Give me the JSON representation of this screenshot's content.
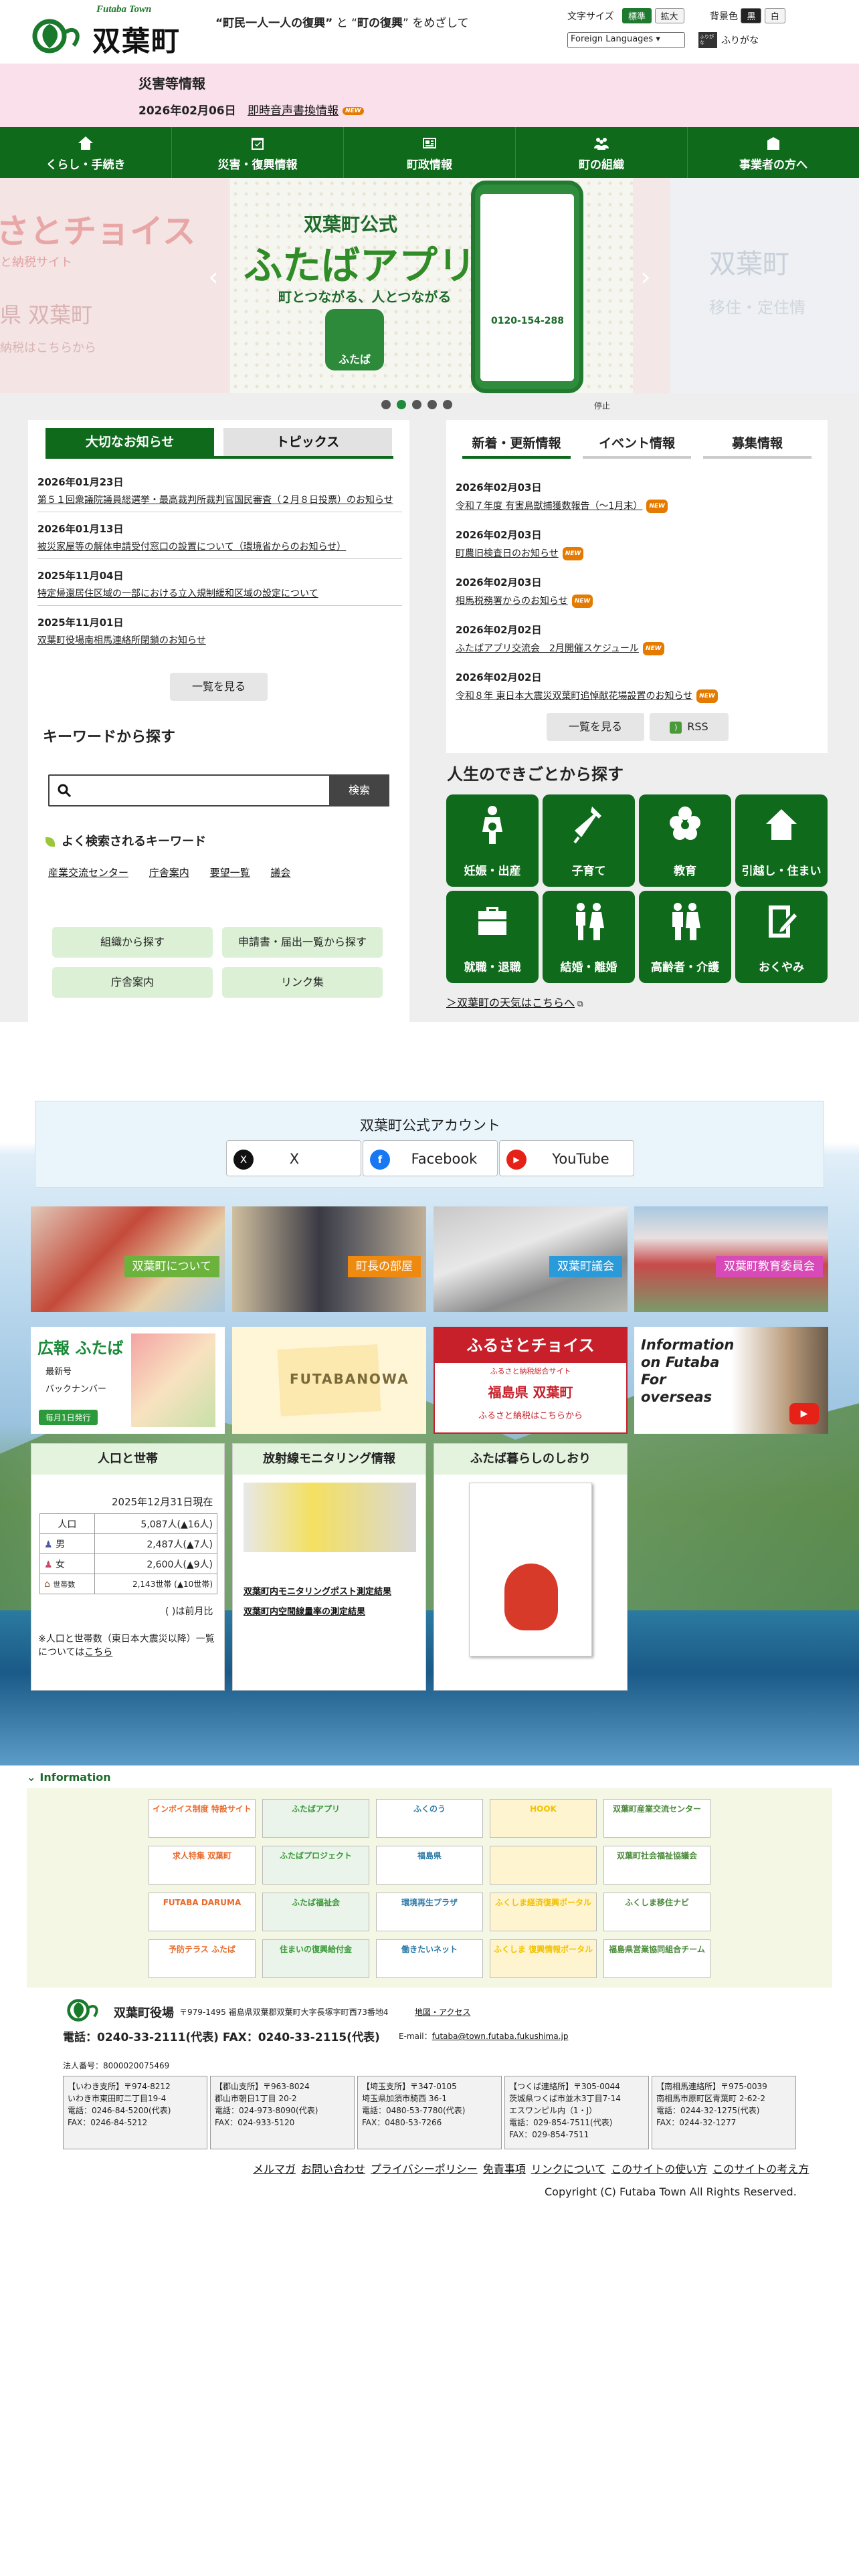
{
  "header": {
    "logo_en": "Futaba Town",
    "logo_jp": "双葉町",
    "slogan_a": "“町民一人一人の復興”",
    "slogan_mid": " と “",
    "slogan_b": "町の復興",
    "slogan_c": "” をめざして",
    "fontsize_label": "文字サイズ",
    "fontsize_std": "標準",
    "fontsize_big": "拡大",
    "bg_label": "背景色",
    "bg_black": "黒",
    "bg_white": "白",
    "lang_select": "Foreign Languages ▾",
    "furigana_icon_label": "ふりがな",
    "furigana": "ふりがな"
  },
  "disaster": {
    "title": "災害等情報",
    "date": "2026年02月06日",
    "link": "即時音声書換情報",
    "new": "NEW"
  },
  "nav": [
    {
      "label": "くらし・手続き"
    },
    {
      "label": "災害・復興情報"
    },
    {
      "label": "町政情報"
    },
    {
      "label": "町の組織"
    },
    {
      "label": "事業者の方へ"
    }
  ],
  "slider": {
    "left_big": "さとチョイス",
    "left_sub": "と納税サイト",
    "left_town": "県 双葉町",
    "left_link": "納税はこちらから",
    "app_t1": "双葉町公式",
    "app_t2": "ふたばアプリ",
    "app_t3": "町とつながる、人とつながる",
    "app_icon": "ふたば",
    "phone_tel": "0120-154-288",
    "right_t1": "双葉町",
    "right_t2": "移住・定住情",
    "stop": "停止",
    "dots": 5,
    "active_dot": 1
  },
  "important": {
    "tab_on": "大切なお知らせ",
    "tab_off": "トピックス",
    "items": [
      {
        "date": "2026年01月23日",
        "text": "第５１回衆議院議員総選挙・最高裁判所裁判官国民審査（２月８日投票）のお知らせ"
      },
      {
        "date": "2026年01月13日",
        "text": "被災家屋等の解体申請受付窓口の設置について（環境省からのお知らせ）"
      },
      {
        "date": "2025年11月04日",
        "text": "特定帰還居住区域の一部における立入規制緩和区域の設定について"
      },
      {
        "date": "2025年11月01日",
        "text": "双葉町役場南相馬連絡所閉鎖のお知らせ"
      }
    ],
    "more": "一覧を見る"
  },
  "keyword": {
    "title": "キーワードから探す",
    "placeholder": "",
    "search_btn": "検索",
    "freq_title": "よく検索されるキーワード",
    "freq": [
      "産業交流センター",
      "庁舎案内",
      "要望一覧",
      "議会"
    ],
    "btns": [
      "組織から探す",
      "申請書・届出一覧から探す",
      "庁舎案内",
      "リンク集"
    ]
  },
  "news": {
    "tabs": [
      "新着・更新情報",
      "イベント情報",
      "募集情報"
    ],
    "items": [
      {
        "date": "2026年02月03日",
        "text": "令和７年度 有害鳥獣捕獲数報告（～1月末）"
      },
      {
        "date": "2026年02月03日",
        "text": "町農旧検査日のお知らせ"
      },
      {
        "date": "2026年02月03日",
        "text": "相馬税務署からのお知らせ"
      },
      {
        "date": "2026年02月02日",
        "text": "ふたばアプリ交流会　2月開催スケジュール"
      },
      {
        "date": "2026年02月02日",
        "text": "令和８年 東日本大震災双葉町追悼献花場設置のお知らせ"
      }
    ],
    "new": "NEW",
    "more": "一覧を見る",
    "rss": "RSS"
  },
  "life": {
    "title": "人生のできごとから探す",
    "items": [
      "妊娠・出産",
      "子育て",
      "教育",
      "引越し・住まい",
      "就職・退職",
      "結婚・離婚",
      "高齢者・介護",
      "おくやみ"
    ],
    "weather": "＞双葉町の天気はこちらへ"
  },
  "sns": {
    "title": "双葉町公式アカウント",
    "items": [
      {
        "label": "X",
        "icon": "X"
      },
      {
        "label": "Facebook",
        "icon": "f"
      },
      {
        "label": "YouTube",
        "icon": "▶"
      }
    ]
  },
  "photos": [
    {
      "label": "双葉町について"
    },
    {
      "label": "町長の部屋"
    },
    {
      "label": "双葉町議会"
    },
    {
      "label": "双葉町教育委員会"
    }
  ],
  "banners": {
    "koho_t": "広報 ふたば",
    "koho_a": "最新号",
    "koho_b": "バックナンバー",
    "koho_c": "毎月1日発行",
    "futabanowa": "FUTABANOWA",
    "furusato_t": "ふるさとチョイス",
    "furusato_s": "ふるさと納税総合サイト",
    "furusato_town": "福島県 双葉町",
    "furusato_link": "ふるさと納税はこちらから",
    "overseas": "Information on Futaba For overseas"
  },
  "population": {
    "title": "人口と世帯",
    "asof": "2025年12月31日現在",
    "rows": [
      {
        "k": "人口",
        "v": "5,087人(▲16人)"
      },
      {
        "k": "男",
        "v": "2,487人(▲7人)"
      },
      {
        "k": "女",
        "v": "2,600人(▲9人)"
      },
      {
        "k": "世帯数",
        "v": "2,143世帯 (▲10世帯)"
      }
    ],
    "note1": "( )は前月比",
    "note2": "※人口と世帯数（東日本大震災以降）一覧については",
    "note_link": "こちら"
  },
  "radiation": {
    "title": "放射線モニタリング情報",
    "l1": "双葉町内モニタリングポスト測定結果",
    "l2": "双葉町内空間線量率の測定結果"
  },
  "guide": {
    "title": "ふたば暮らしのしおり"
  },
  "info": {
    "title": "Information",
    "banners": [
      [
        "インボイス制度 特設サイト",
        "ふたばアプリ",
        "ふくのう",
        "HOOK",
        "双葉町産業交流センター"
      ],
      [
        "求人特集 双葉町",
        "ふたばプロジェクト",
        "福島県",
        "",
        "双葉町社会福祉協議会"
      ],
      [
        "FUTABA DARUMA",
        "ふたば福祉会",
        "環境再生プラザ",
        "ふくしま経済復興ポータル",
        "ふくしま移住ナビ"
      ],
      [
        "予防テラス ふたば",
        "住まいの復興給付金",
        "働きたいネット",
        "ふくしま 復興情報ポータル",
        "福島県営業協同組合チーム"
      ]
    ]
  },
  "footer": {
    "name": "双葉町役場",
    "addr": "〒979-1495 福島県双葉郡双葉町大字長塚字町西73番地4",
    "map": "地図・アクセス",
    "tel": "電話：0240-33-2111(代表) FAX：0240-33-2115(代表)",
    "email_label": "E-mail：",
    "email": "futaba@town.futaba.fukushima.jp",
    "corp": "法人番号：8000020075469",
    "branches": [
      [
        "【いわき支所】〒974-8212",
        "いわき市東田町二丁目19-4",
        "電話：0246-84-5200(代表)",
        "FAX：0246-84-5212"
      ],
      [
        "【郡山支所】〒963-8024",
        "郡山市朝日1丁目 20-2",
        "電話：024-973-8090(代表)",
        "FAX：024-933-5120"
      ],
      [
        "【埼玉支所】〒347-0105",
        "埼玉県加須市騎西 36-1",
        "電話：0480-53-7780(代表)",
        "FAX：0480-53-7266"
      ],
      [
        "【つくば連絡所】〒305-0044",
        "茨城県つくば市並木3丁目7-14",
        "エスワンピル内（1・J）",
        "電話：029-854-7511(代表)",
        "FAX：029-854-7511"
      ],
      [
        "【南相馬連絡所】〒975-0039",
        "南相馬市原町区青葉町 2-62-2",
        "電話：0244-32-1275(代表)",
        "FAX：0244-32-1277"
      ]
    ],
    "links": [
      "メルマガ",
      "お問い合わせ",
      "プライバシーポリシー",
      "免責事項",
      "リンクについて",
      "このサイトの使い方",
      "このサイトの考え方"
    ],
    "copyright": "Copyright (C) Futaba Town All Rights Reserved."
  }
}
